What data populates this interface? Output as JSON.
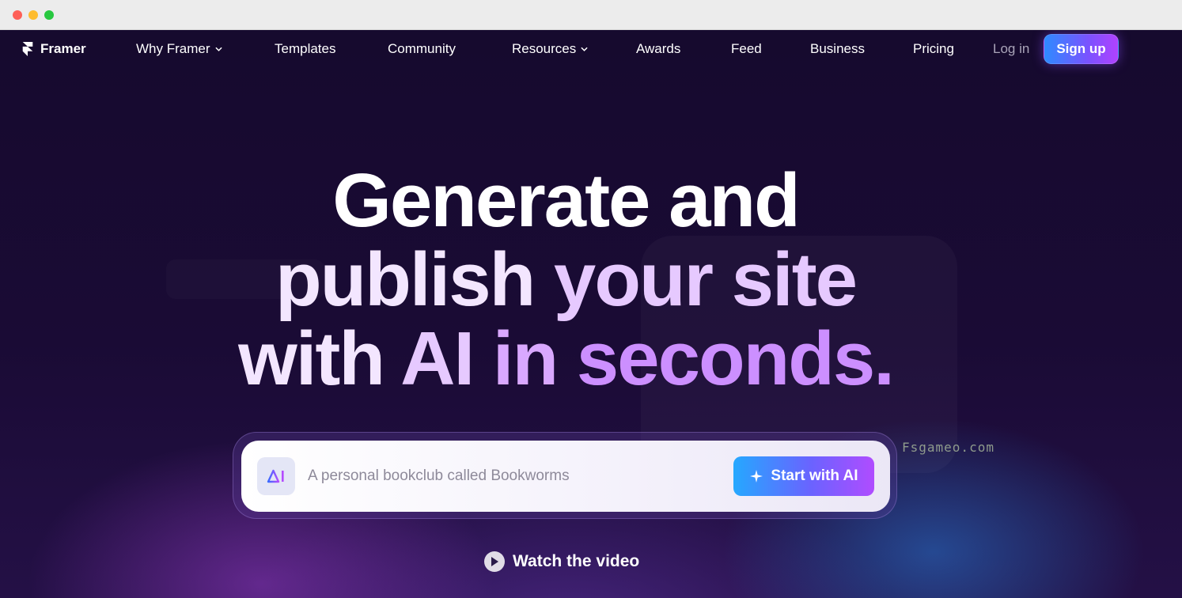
{
  "brand": {
    "name": "Framer"
  },
  "nav": {
    "items": [
      {
        "label": "Why Framer",
        "has_dropdown": true
      },
      {
        "label": "Templates",
        "has_dropdown": false
      },
      {
        "label": "Community",
        "has_dropdown": false
      },
      {
        "label": "Resources",
        "has_dropdown": true
      },
      {
        "label": "Awards",
        "has_dropdown": false
      },
      {
        "label": "Feed",
        "has_dropdown": false
      },
      {
        "label": "Business",
        "has_dropdown": false
      },
      {
        "label": "Pricing",
        "has_dropdown": false
      }
    ],
    "login_label": "Log in",
    "signup_label": "Sign up"
  },
  "hero": {
    "line1": "Generate and",
    "line2a": "publish",
    "line2b": "your site",
    "line3a": "with",
    "line3b": "AI",
    "line3c": "in",
    "line3d": "seconds."
  },
  "prompt": {
    "badge": "AI",
    "placeholder": "A personal bookclub called Bookworms",
    "button_label": "Start with AI"
  },
  "watch_video_label": "Watch the video",
  "watermark": "Fsgameo.com",
  "colors": {
    "background": "#14082a",
    "accent_blue": "#2e8bff",
    "accent_purple": "#b042ff"
  }
}
